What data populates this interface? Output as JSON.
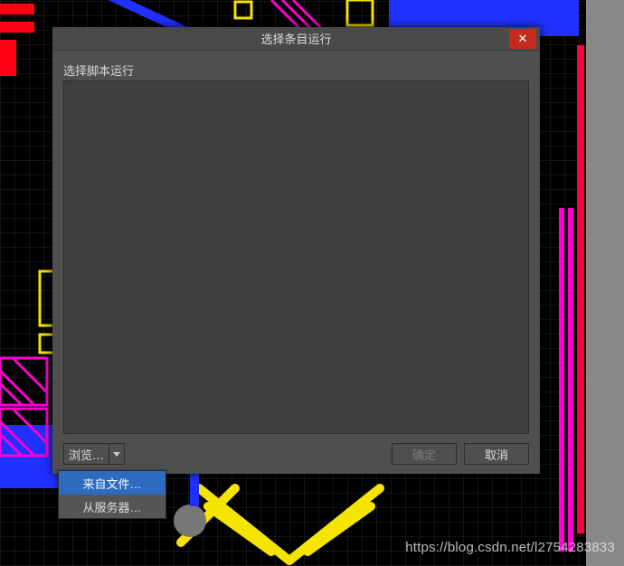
{
  "dialog": {
    "title": "选择条目运行",
    "panel_label": "选择脚本运行",
    "browse_label": "浏览…",
    "ok_label": "确定",
    "cancel_label": "取消"
  },
  "menu": {
    "items": [
      {
        "label": "来自文件…",
        "highlighted": true
      },
      {
        "label": "从服务器…",
        "highlighted": false
      }
    ]
  },
  "watermark": "https://blog.csdn.net/l2754283833"
}
